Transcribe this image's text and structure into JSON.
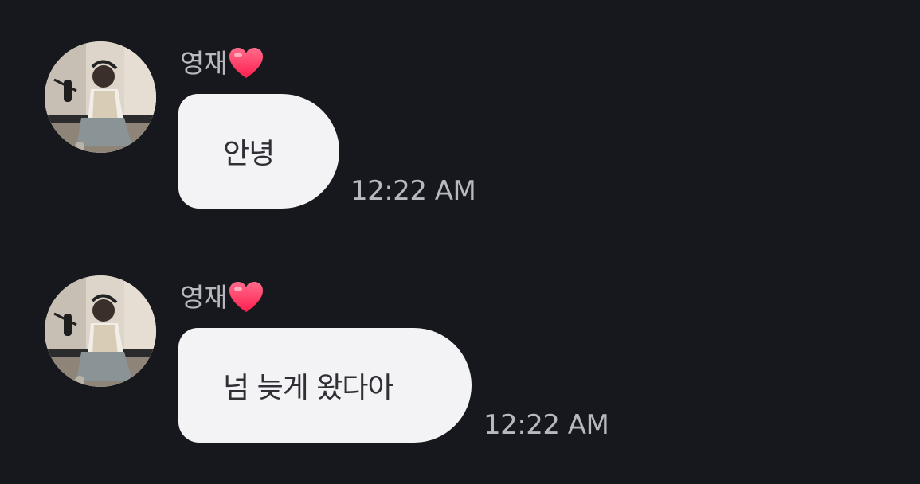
{
  "messages": [
    {
      "sender": "영재",
      "sender_emoji": "heart-icon",
      "text": "안녕",
      "time": "12:22 AM"
    },
    {
      "sender": "영재",
      "sender_emoji": "heart-icon",
      "text": "넘 늦게 왔다아",
      "time": "12:22 AM"
    }
  ],
  "colors": {
    "background": "#17181d",
    "bubble": "#f3f3f5",
    "bubble_text": "#2f3036",
    "meta_text": "#b8b9c0",
    "heart": "#ff2f5c"
  }
}
